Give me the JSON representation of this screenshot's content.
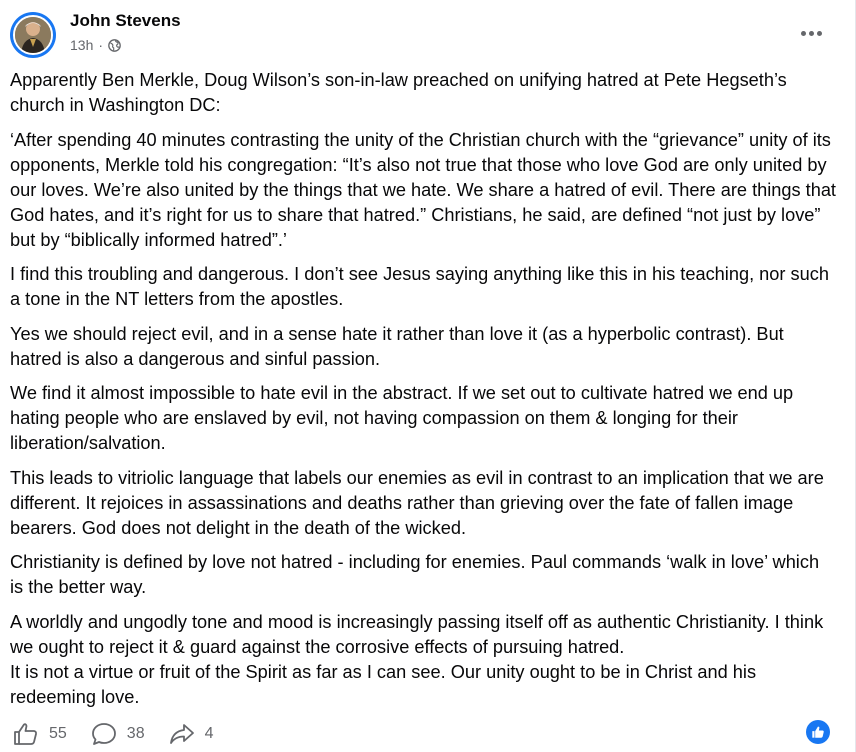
{
  "post": {
    "author": "John Stevens",
    "time": "13h",
    "separator": "·",
    "paragraphs": [
      "Apparently Ben Merkle, Doug Wilson’s son-in-law preached on unifying hatred at Pete Hegseth’s church in Washington DC:",
      "‘After spending 40 minutes contrasting the unity of the Christian church with the “grievance” unity of its opponents, Merkle told his congregation: “It’s also not true that those who love God are only united by our loves. We’re also united by the things that we hate. We share a hatred of evil. There are things that God hates, and it’s right for us to share that hatred.” Christians, he said, are defined “not just by love” but by “biblically informed hatred”.’",
      "I find this troubling and dangerous. I don’t see Jesus saying anything like this in his teaching, nor such a tone in the NT letters from the apostles.",
      "Yes we should reject evil, and in a sense hate it rather than love it (as a hyperbolic contrast). But hatred is also a dangerous and sinful passion.",
      "We find it almost impossible to hate evil in the abstract. If we set out to cultivate hatred we end up hating people who are enslaved by evil, not having compassion on them & longing for their liberation/salvation.",
      "This leads to vitriolic language that labels our enemies as evil in contrast to an implication that we are different. It rejoices in assassinations and deaths rather than grieving over the fate of fallen image bearers. God does not delight in the death of the wicked.",
      "Christianity is defined by love not hatred - including for enemies. Paul commands ‘walk in love’ which is the better way."
    ],
    "final_lines": [
      "A worldly and ungodly tone and mood is increasingly passing itself off as authentic Christianity. I think we ought to reject it & guard against the corrosive effects of pursuing hatred.",
      "It is not a virtue or fruit of the Spirit as far as I can see. Our unity ought to be in Christ and his redeeming love."
    ]
  },
  "actions": {
    "likes": "55",
    "comments": "38",
    "shares": "4"
  },
  "icons": {
    "visibility": "globe-icon",
    "more": "more-options-icon",
    "like": "thumbs-up-icon",
    "comment": "comment-icon",
    "share": "share-icon"
  },
  "colors": {
    "accent": "#1877f2",
    "secondary_text": "#65676b",
    "primary_text": "#080809"
  }
}
